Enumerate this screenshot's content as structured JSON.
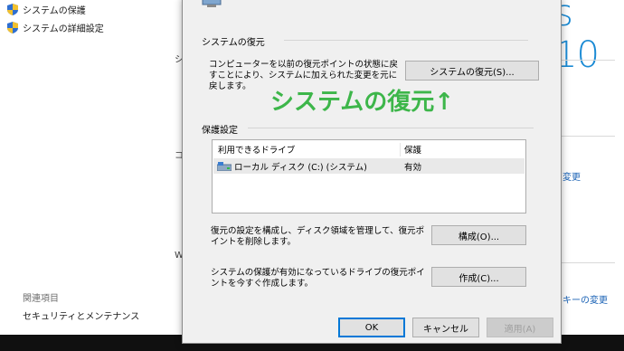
{
  "background": {
    "left_links": [
      {
        "label": "システムの保護"
      },
      {
        "label": "システムの詳細設定"
      }
    ],
    "related_heading": "関連項目",
    "related_link": "セキュリティとメンテナンス",
    "fragments": [
      "シ",
      "コ",
      "W"
    ],
    "brand_text": "s 10",
    "right_links": [
      "変更",
      "キーの変更"
    ]
  },
  "dialog": {
    "restore_group_title": "システムの復元",
    "restore_description": "コンピューターを以前の復元ポイントの状態に戻すことにより、システムに加えられた変更を元に戻します。",
    "restore_button": "システムの復元(S)...",
    "annotation": "システムの復元↑",
    "protection_group_title": "保護設定",
    "drive_table": {
      "columns": [
        "利用できるドライブ",
        "保護"
      ],
      "rows": [
        {
          "drive": "ローカル ディスク (C:) (システム)",
          "protection": "有効"
        }
      ]
    },
    "configure_description": "復元の設定を構成し、ディスク領域を管理して、復元ポイントを削除します。",
    "configure_button": "構成(O)...",
    "create_description": "システムの保護が有効になっているドライブの復元ポイントを今すぐ作成します。",
    "create_button": "作成(C)...",
    "ok_button": "OK",
    "cancel_button": "キャンセル",
    "apply_button": "適用(A)"
  },
  "colors": {
    "annotation": "#3db64a",
    "link": "#1a62b5",
    "brand": "#1a8ad4",
    "accent_border": "#0078d7"
  }
}
